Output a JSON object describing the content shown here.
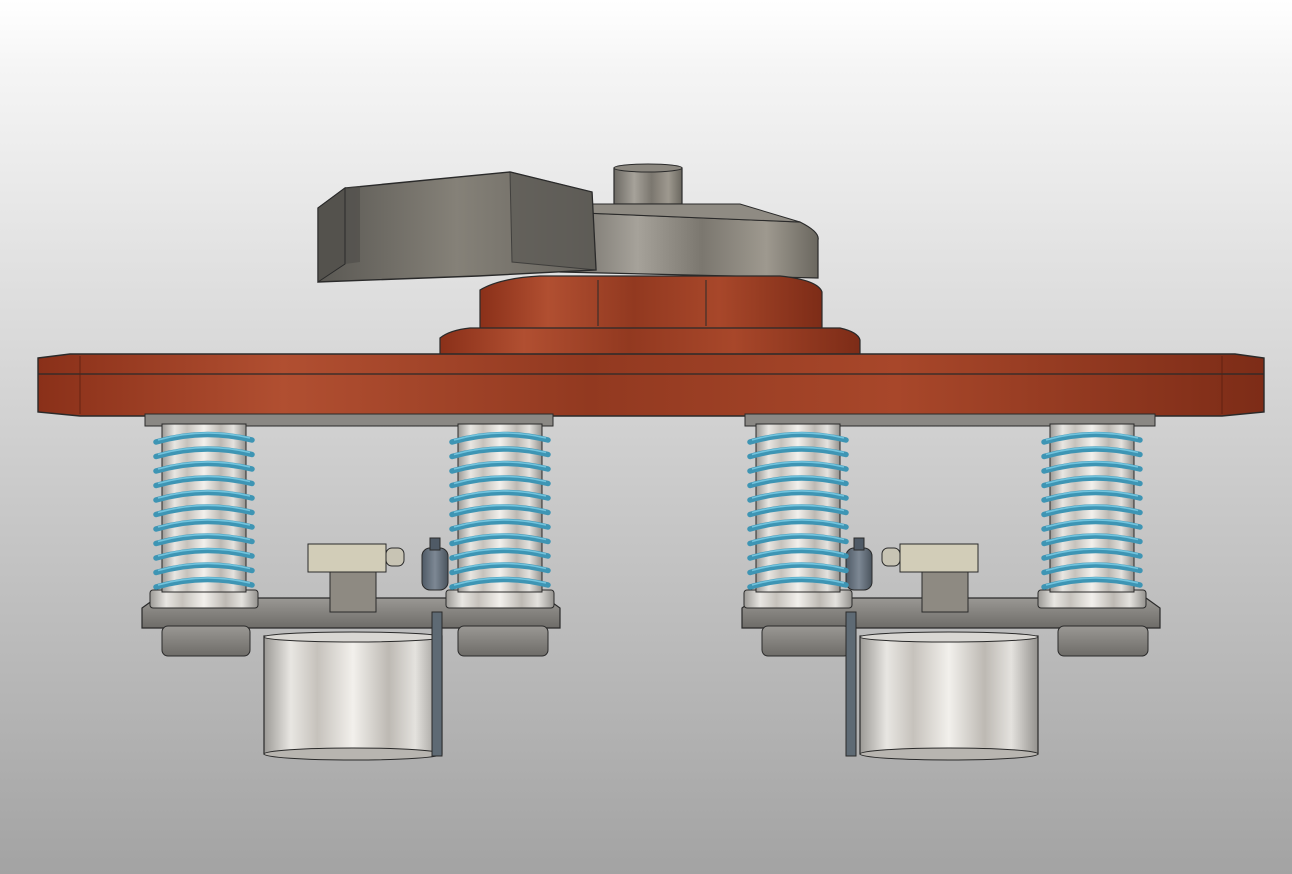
{
  "viewport": {
    "background_top": "#ffffff",
    "background_bottom": "#a3a3a3"
  },
  "colors": {
    "copper": "#9a3a22",
    "copper_dark": "#6e2614",
    "copper_light": "#b8563a",
    "steel": "#c9c7c2",
    "steel_dark": "#8a8884",
    "steel_light": "#eeeeec",
    "plate_gray": "#808080",
    "gearbox": "#6c6a65",
    "spring": "#3e95b4",
    "spring_light": "#7fd0e8",
    "edge": "#2a2a2a"
  },
  "model": {
    "parts": [
      "gear-motor-housing",
      "motor-hub",
      "copper-flange",
      "copper-top-plate",
      "spring-assembly",
      "sensor-block",
      "fitting-knob",
      "base-plate",
      "steel-cylinder",
      "rod"
    ],
    "spring_count": 4,
    "sensor_count": 2
  }
}
